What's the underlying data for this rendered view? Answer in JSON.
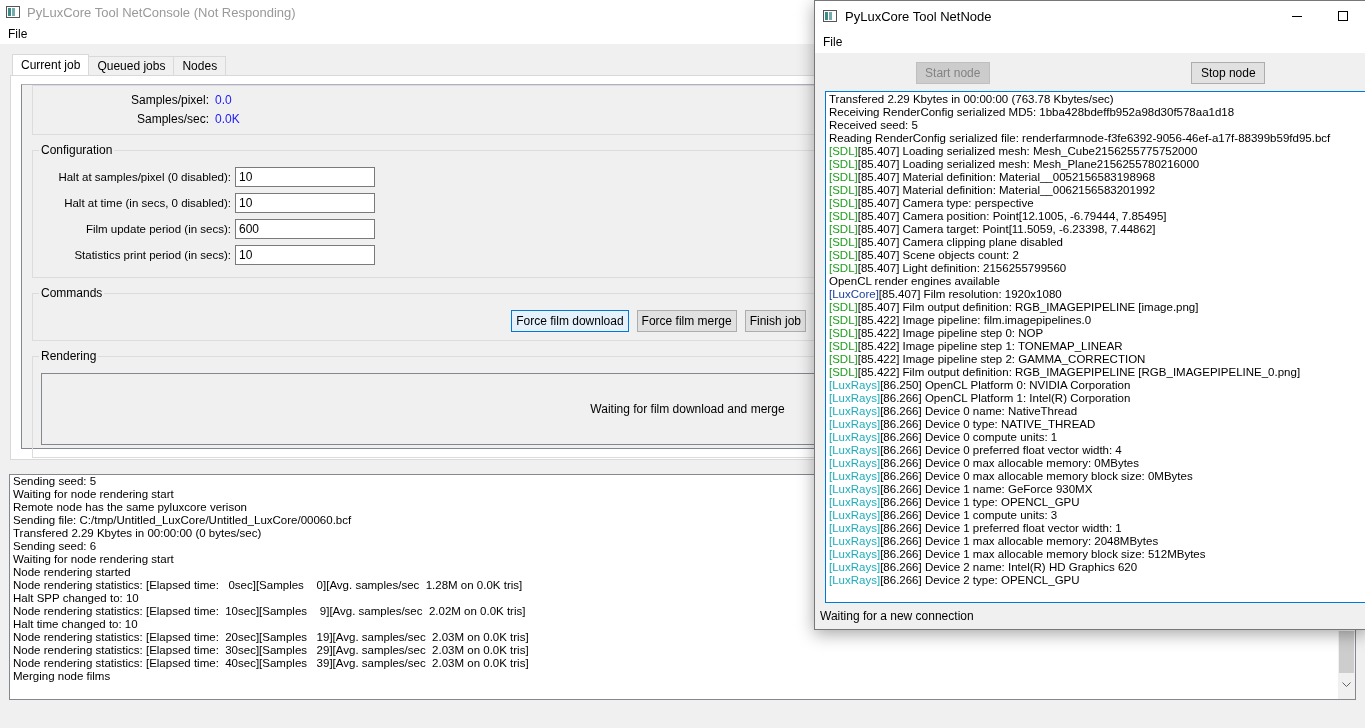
{
  "console_window": {
    "title": "PyLuxCore Tool NetConsole (Not Responding)",
    "menu": [
      "File"
    ],
    "tabs": [
      {
        "label": "Current job",
        "selected": true
      },
      {
        "label": "Queued jobs",
        "selected": false
      },
      {
        "label": "Nodes",
        "selected": false
      }
    ],
    "statistics": [
      {
        "label": "Samples/pixel:",
        "value": "0.0"
      },
      {
        "label": "Samples/sec:",
        "value": "0.0K"
      }
    ],
    "configuration": {
      "title": "Configuration",
      "fields": [
        {
          "label": "Halt at samples/pixel (0 disabled):",
          "value": "10"
        },
        {
          "label": "Halt at time (in secs, 0 disabled):",
          "value": "10"
        },
        {
          "label": "Film update period (in secs):",
          "value": "600"
        },
        {
          "label": "Statistics print period (in secs):",
          "value": "10"
        }
      ]
    },
    "commands": {
      "title": "Commands",
      "buttons": [
        {
          "label": "Force film download",
          "focused": true
        },
        {
          "label": "Force film merge",
          "focused": false
        },
        {
          "label": "Finish job",
          "focused": false
        }
      ]
    },
    "rendering": {
      "title": "Rendering",
      "message": "Waiting for film download and merge"
    },
    "log": [
      "Sending seed: 5",
      "Waiting for node rendering start",
      "Remote node has the same pyluxcore verison",
      "Sending file: C:/tmp/Untitled_LuxCore/Untitled_LuxCore/00060.bcf",
      "Transfered 2.29 Kbytes in 00:00:00 (0 bytes/sec)",
      "Sending seed: 6",
      "Waiting for node rendering start",
      "Node rendering started",
      "Node rendering statistics: [Elapsed time:   0sec][Samples    0][Avg. samples/sec  1.28M on 0.0K tris]",
      "Halt SPP changed to: 10",
      "Node rendering statistics: [Elapsed time:  10sec][Samples    9][Avg. samples/sec  2.02M on 0.0K tris]",
      "Halt time changed to: 10",
      "Node rendering statistics: [Elapsed time:  20sec][Samples   19][Avg. samples/sec  2.03M on 0.0K tris]",
      "Node rendering statistics: [Elapsed time:  30sec][Samples   29][Avg. samples/sec  2.03M on 0.0K tris]",
      "Node rendering statistics: [Elapsed time:  40sec][Samples   39][Avg. samples/sec  2.03M on 0.0K tris]",
      "Merging node films"
    ]
  },
  "node_window": {
    "title": "PyLuxCore Tool NetNode",
    "menu": [
      "File"
    ],
    "buttons": [
      {
        "label": "Start node",
        "disabled": true
      },
      {
        "label": "Stop node",
        "disabled": false
      }
    ],
    "log": [
      {
        "text": "Transfered 2.29 Kbytes in 00:00:00 (763.78 Kbytes/sec)"
      },
      {
        "text": "Receiving RenderConfig serialized MD5: 1bba428bdeffb952a98d30f578aa1d18"
      },
      {
        "text": "Received seed: 5"
      },
      {
        "text": "Reading RenderConfig serialized file: renderfarmnode-f3fe6392-9056-46ef-a17f-88399b59fd95.bcf"
      },
      {
        "tag": "[SDL]",
        "color": "#1e9e1e",
        "text": "[85.407] Loading serialized mesh: Mesh_Cube2156255775752000"
      },
      {
        "tag": "[SDL]",
        "color": "#1e9e1e",
        "text": "[85.407] Loading serialized mesh: Mesh_Plane2156255780216000"
      },
      {
        "tag": "[SDL]",
        "color": "#1e9e1e",
        "text": "[85.407] Material definition: Material__0052156583198968"
      },
      {
        "tag": "[SDL]",
        "color": "#1e9e1e",
        "text": "[85.407] Material definition: Material__0062156583201992"
      },
      {
        "tag": "[SDL]",
        "color": "#1e9e1e",
        "text": "[85.407] Camera type: perspective"
      },
      {
        "tag": "[SDL]",
        "color": "#1e9e1e",
        "text": "[85.407] Camera position: Point[12.1005, -6.79444, 7.85495]"
      },
      {
        "tag": "[SDL]",
        "color": "#1e9e1e",
        "text": "[85.407] Camera target: Point[11.5059, -6.23398, 7.44862]"
      },
      {
        "tag": "[SDL]",
        "color": "#1e9e1e",
        "text": "[85.407] Camera clipping plane disabled"
      },
      {
        "tag": "[SDL]",
        "color": "#1e9e1e",
        "text": "[85.407] Scene objects count: 2"
      },
      {
        "tag": "[SDL]",
        "color": "#1e9e1e",
        "text": "[85.407] Light definition: 2156255799560"
      },
      {
        "text": "OpenCL render engines available"
      },
      {
        "tag": "[LuxCore]",
        "color": "#1c3f9e",
        "text": "[85.407] Film resolution: 1920x1080"
      },
      {
        "tag": "[SDL]",
        "color": "#1e9e1e",
        "text": "[85.407] Film output definition: RGB_IMAGEPIPELINE [image.png]"
      },
      {
        "tag": "[SDL]",
        "color": "#1e9e1e",
        "text": "[85.422] Image pipeline: film.imagepipelines.0"
      },
      {
        "tag": "[SDL]",
        "color": "#1e9e1e",
        "text": "[85.422] Image pipeline step 0: NOP"
      },
      {
        "tag": "[SDL]",
        "color": "#1e9e1e",
        "text": "[85.422] Image pipeline step 1: TONEMAP_LINEAR"
      },
      {
        "tag": "[SDL]",
        "color": "#1e9e1e",
        "text": "[85.422] Image pipeline step 2: GAMMA_CORRECTION"
      },
      {
        "tag": "[SDL]",
        "color": "#1e9e1e",
        "text": "[85.422] Film output definition: RGB_IMAGEPIPELINE [RGB_IMAGEPIPELINE_0.png]"
      },
      {
        "tag": "[LuxRays]",
        "color": "#1eaebb",
        "text": "[86.250] OpenCL Platform 0: NVIDIA Corporation"
      },
      {
        "tag": "[LuxRays]",
        "color": "#1eaebb",
        "text": "[86.266] OpenCL Platform 1: Intel(R) Corporation"
      },
      {
        "tag": "[LuxRays]",
        "color": "#1eaebb",
        "text": "[86.266] Device 0 name: NativeThread"
      },
      {
        "tag": "[LuxRays]",
        "color": "#1eaebb",
        "text": "[86.266] Device 0 type: NATIVE_THREAD"
      },
      {
        "tag": "[LuxRays]",
        "color": "#1eaebb",
        "text": "[86.266] Device 0 compute units: 1"
      },
      {
        "tag": "[LuxRays]",
        "color": "#1eaebb",
        "text": "[86.266] Device 0 preferred float vector width: 4"
      },
      {
        "tag": "[LuxRays]",
        "color": "#1eaebb",
        "text": "[86.266] Device 0 max allocable memory: 0MBytes"
      },
      {
        "tag": "[LuxRays]",
        "color": "#1eaebb",
        "text": "[86.266] Device 0 max allocable memory block size: 0MBytes"
      },
      {
        "tag": "[LuxRays]",
        "color": "#1eaebb",
        "text": "[86.266] Device 1 name: GeForce 930MX"
      },
      {
        "tag": "[LuxRays]",
        "color": "#1eaebb",
        "text": "[86.266] Device 1 type: OPENCL_GPU"
      },
      {
        "tag": "[LuxRays]",
        "color": "#1eaebb",
        "text": "[86.266] Device 1 compute units: 3"
      },
      {
        "tag": "[LuxRays]",
        "color": "#1eaebb",
        "text": "[86.266] Device 1 preferred float vector width: 1"
      },
      {
        "tag": "[LuxRays]",
        "color": "#1eaebb",
        "text": "[86.266] Device 1 max allocable memory: 2048MBytes"
      },
      {
        "tag": "[LuxRays]",
        "color": "#1eaebb",
        "text": "[86.266] Device 1 max allocable memory block size: 512MBytes"
      },
      {
        "tag": "[LuxRays]",
        "color": "#1eaebb",
        "text": "[86.266] Device 2 name: Intel(R) HD Graphics 620"
      },
      {
        "tag": "[LuxRays]",
        "color": "#1eaebb",
        "text": "[86.266] Device 2 type: OPENCL_GPU"
      }
    ],
    "status": "Waiting for a new connection"
  }
}
